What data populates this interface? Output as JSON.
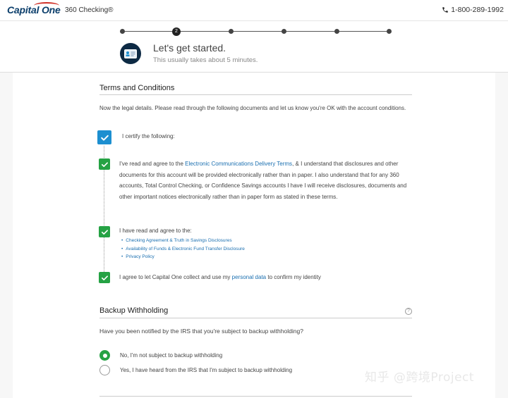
{
  "header": {
    "brand": "Capital One",
    "product": "360 Checking®",
    "phone": "1-800-289-1992"
  },
  "progress": {
    "active_step": "2",
    "title": "Let's get started.",
    "subtitle": "This usually takes about 5 minutes."
  },
  "terms": {
    "heading": "Terms and Conditions",
    "intro": "Now the legal details. Please read through the following documents and let us know you're OK with the account conditions.",
    "certify_label": "I certify the following:",
    "item1_prefix": "I've read and agree to the ",
    "item1_link": "Electronic Communications Delivery Terms",
    "item1_suffix": ", & I understand that disclosures and other documents for this account will be provided electronically rather than in paper. I also understand that for any 360 accounts, Total Control Checking, or Confidence Savings accounts I have I will receive disclosures, documents and other important notices electronically rather than in paper form as stated in these terms.",
    "item2_label": "I have read and agree to the:",
    "item2_links": [
      "Checking Agreement & Truth in Savings Disclosures",
      "Availability of Funds & Electronic Fund Transfer Disclosure",
      "Privacy Policy"
    ],
    "item3_prefix": "I agree to let Capital One collect and use my ",
    "item3_link": "personal data",
    "item3_suffix": " to confirm my identity"
  },
  "backup": {
    "heading": "Backup Withholding",
    "help": "?",
    "question": "Have you been notified by the IRS that you're subject to backup withholding?",
    "options": [
      "No, I'm not subject to backup withholding",
      "Yes, I have heard from the IRS that I'm subject to backup withholding"
    ],
    "selected": "No, I'm not subject to backup withholding"
  },
  "watermark": "知乎 @跨境Project",
  "colors": {
    "brand_navy": "#0b3e6b",
    "brand_red": "#d03027",
    "check_green": "#25a244",
    "check_blue": "#1c8fd0",
    "link_blue": "#1a6fb0"
  }
}
